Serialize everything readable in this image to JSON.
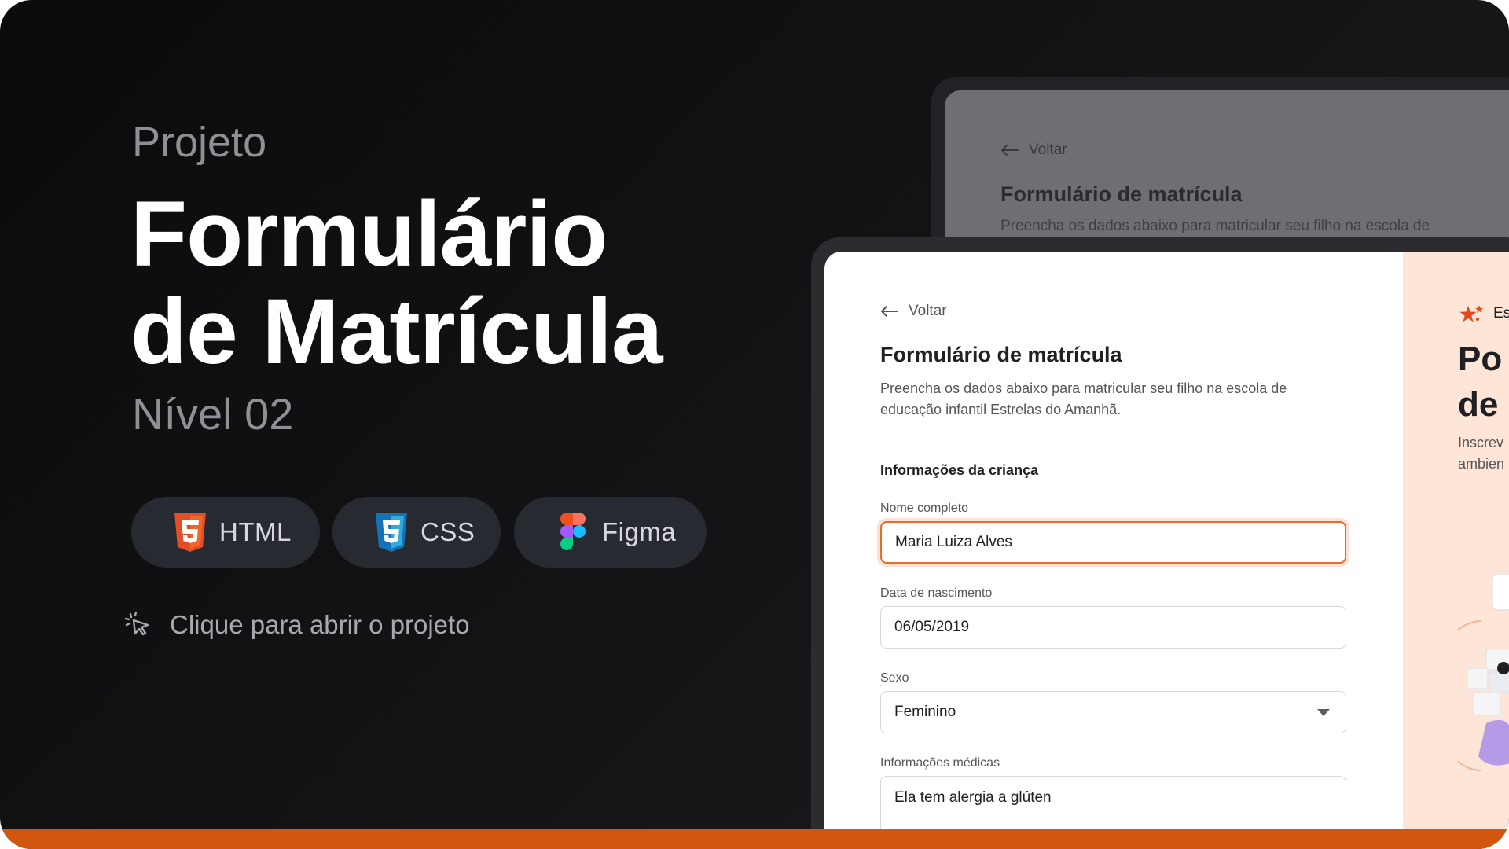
{
  "hero": {
    "eyebrow": "Projeto",
    "title_line1": "Formulário",
    "title_line2": "de Matrícula",
    "level": "Nível 02"
  },
  "tech_pills": [
    {
      "label": "HTML",
      "icon": "html5-icon",
      "color": "#e44d26"
    },
    {
      "label": "CSS",
      "icon": "css3-icon",
      "color": "#1f88d8"
    },
    {
      "label": "Figma",
      "icon": "figma-icon",
      "color": "#f24e1e"
    }
  ],
  "cta": {
    "label": "Clique para abrir o projeto",
    "icon": "pointer-click-icon"
  },
  "mock_back": {
    "back_label": "Voltar",
    "title": "Formulário de matrícula",
    "description": "Preencha os dados abaixo para matricular seu filho na escola de"
  },
  "form": {
    "back_label": "Voltar",
    "title": "Formulário de matrícula",
    "description": "Preencha os dados abaixo para matricular seu filho na escola de educação infantil Estrelas do Amanhã.",
    "section_title": "Informações da criança",
    "fields": {
      "full_name": {
        "label": "Nome completo",
        "value": "Maria Luiza Alves"
      },
      "birth_date": {
        "label": "Data de nascimento",
        "value": "06/05/2019"
      },
      "sex": {
        "label": "Sexo",
        "value": "Feminino"
      },
      "medical_info": {
        "label": "Informações médicas",
        "value": "Ela tem alergia a glúten"
      }
    }
  },
  "side_panel": {
    "logo_text": "Es",
    "title_line1": "Po",
    "title_line2": "de",
    "desc_line1": "Inscrev",
    "desc_line2": "ambien"
  },
  "colors": {
    "accent": "#d2560f",
    "input_focus": "#ec6a2a",
    "side_panel_bg": "#fde6d8"
  }
}
